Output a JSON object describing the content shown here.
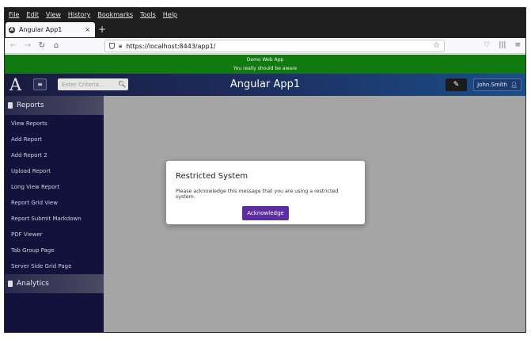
{
  "browser": {
    "menu": [
      "File",
      "Edit",
      "View",
      "History",
      "Bookmarks",
      "Tools",
      "Help"
    ],
    "tab_title": "Angular App1",
    "tab_close": "×",
    "new_tab": "+",
    "url": "https://localhost:8443/app1/",
    "icons": {
      "back": "back-arrow-icon",
      "forward": "forward-arrow-icon",
      "reload": "reload-icon",
      "home": "home-icon",
      "bookmark": "star-icon",
      "pocket": "pocket-icon",
      "library": "library-icon",
      "menu": "hamburger-menu-icon"
    }
  },
  "banner": {
    "line1": "Demo Web App",
    "line2": "You really should be aware",
    "color": "#107a10"
  },
  "header": {
    "logo": "A",
    "search_placeholder": "Enter Criteria...",
    "title": "Angular App1",
    "user": "John.Smith"
  },
  "sidebar": {
    "sections": [
      {
        "label": "Reports",
        "items": [
          "View Reports",
          "Add Report",
          "Add Report 2",
          "Upload Report",
          "Long View Report",
          "Report Grid View",
          "Report Submit Markdown",
          "PDF Viewer",
          "Tab Group Page",
          "Server Side Grid Page"
        ]
      },
      {
        "label": "Analytics",
        "items": []
      }
    ]
  },
  "dialog": {
    "title": "Restricted System",
    "message": "Please acknowledge this message that you are using a restricted system.",
    "button": "Acknowledge",
    "button_color": "#5c2ea0"
  }
}
